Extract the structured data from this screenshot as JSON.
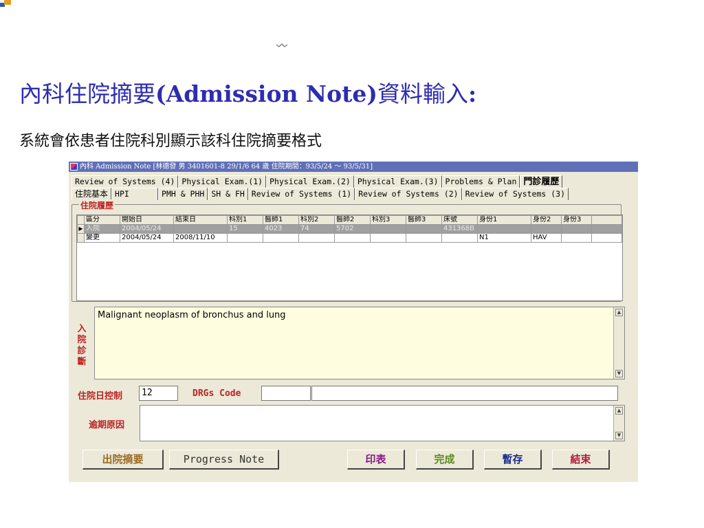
{
  "slide": {
    "title_cjk_1": "內科住院摘要",
    "title_latin": "(Admission Note)",
    "title_cjk_2": "資料輸入",
    "title_colon": ":",
    "subtitle": "系統會依患者住院科別顯示該科住院摘要格式"
  },
  "window": {
    "title": "內科 Admission Note [林德發  男  3401601-8  29/1/6  64 歲  住院期間：93/5/24 ～ 93/5/31]"
  },
  "tabs_row1": [
    {
      "label": "Review of Systems (4)"
    },
    {
      "label": "Physical Exam.(1)"
    },
    {
      "label": "Physical Exam.(2)"
    },
    {
      "label": "Physical Exam.(3)"
    },
    {
      "label": "Problems & Plan"
    },
    {
      "label": "門診履歷"
    }
  ],
  "tabs_row2": [
    {
      "label": "住院基本"
    },
    {
      "label": "HPI"
    },
    {
      "label": "PMH & PHH"
    },
    {
      "label": "SH & FH"
    },
    {
      "label": "Review of Systems (1)"
    },
    {
      "label": "Review of Systems (2)"
    },
    {
      "label": "Review of Systems (3)"
    }
  ],
  "history": {
    "group_label": "住院履歷",
    "columns": [
      "區分",
      "開始日",
      "結束日",
      "科別1",
      "醫師1",
      "科別2",
      "醫師2",
      "科別3",
      "醫師3",
      "床號",
      "身份1",
      "身份2",
      "身份3"
    ],
    "rows": [
      {
        "indicator": "▶",
        "cells": [
          "入院",
          "2004/05/24",
          "",
          "15",
          "4023",
          "74",
          "5702",
          "",
          "",
          "431368B",
          "",
          "",
          ""
        ]
      },
      {
        "indicator": "",
        "cells": [
          "變更",
          "2004/05/24",
          "2008/11/10",
          "",
          "",
          "",
          "",
          "",
          "",
          "",
          "N1",
          "HAV",
          ""
        ]
      }
    ]
  },
  "diagnosis": {
    "label_chars": [
      "入",
      "院",
      "診",
      "斷"
    ],
    "text": "Malignant neoplasm of bronchus and lung"
  },
  "controls": {
    "days_label": "住院日控制",
    "days_value": "12",
    "drg_label": "DRGs Code",
    "drg_code": "",
    "drg_desc": "",
    "reason_label": "逾期原因",
    "reason_value": ""
  },
  "buttons": {
    "discharge": "出院摘要",
    "progress": "Progress Note",
    "print": "印表",
    "complete": "完成",
    "save": "暫存",
    "close": "結束"
  },
  "colors": {
    "title_blue": "#2d2db0",
    "label_red": "#b22222",
    "btn_brown": "#9a6a20",
    "btn_purple": "#8a1a8a",
    "btn_green": "#5a8a20",
    "btn_navy": "#1a2a8a",
    "btn_crimson": "#b01a3a"
  }
}
